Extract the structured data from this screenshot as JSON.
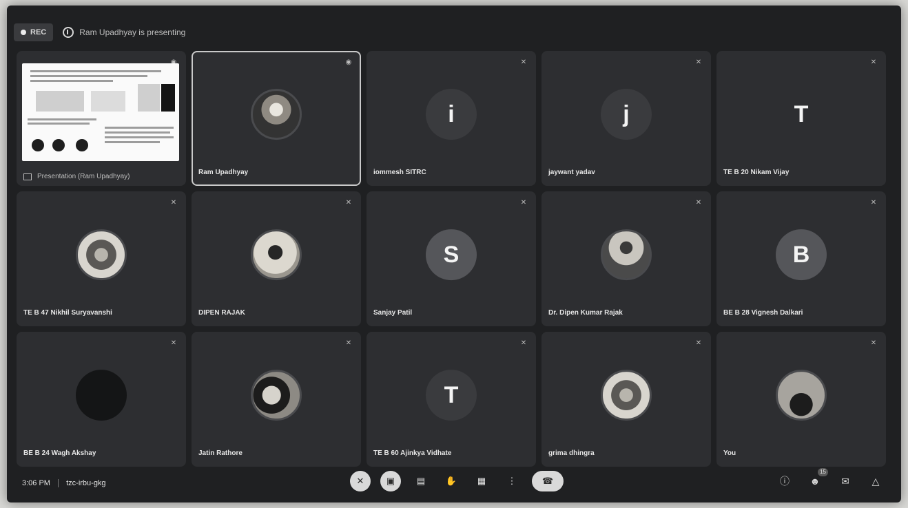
{
  "topbar": {
    "rec_label": "REC",
    "presenting_text": "Ram Upadhyay is presenting"
  },
  "presentation": {
    "label": "Presentation (Ram Upadhyay)"
  },
  "tiles": [
    {
      "name": "Ram Upadhyay",
      "avatar_type": "photo"
    },
    {
      "name": "iommesh SITRC",
      "avatar_letter": "i"
    },
    {
      "name": "jaywant yadav",
      "avatar_letter": "j"
    },
    {
      "name": "TE B 20 Nikam Vijay",
      "avatar_letter": "T"
    },
    {
      "name": "TE B 47 Nikhil Suryavanshi",
      "avatar_type": "photo"
    },
    {
      "name": "DIPEN RAJAK",
      "avatar_type": "photo"
    },
    {
      "name": "Sanjay Patil",
      "avatar_letter": "S"
    },
    {
      "name": "Dr. Dipen Kumar Rajak",
      "avatar_type": "photo"
    },
    {
      "name": "BE B 28 Vignesh Dalkari",
      "avatar_letter": "B"
    },
    {
      "name": "BE B 24 Wagh Akshay",
      "avatar_type": "dark"
    },
    {
      "name": "Jatin Rathore",
      "avatar_type": "photo"
    },
    {
      "name": "TE B 60 Ajinkya Vidhate",
      "avatar_letter": "T"
    },
    {
      "name": "grima dhingra",
      "avatar_type": "photo"
    },
    {
      "name": "You",
      "avatar_type": "photo"
    }
  ],
  "bottombar": {
    "time": "3:06 PM",
    "meeting_code": "tzc-irbu-gkg"
  },
  "controls": {
    "mic": "mic-off-icon",
    "camera": "camera-off-icon",
    "captions": "captions-icon",
    "hand": "raise-hand-icon",
    "present": "present-icon",
    "more": "more-options-icon",
    "end": "end-call-icon"
  },
  "right_icons": {
    "participants_badge": "15"
  }
}
